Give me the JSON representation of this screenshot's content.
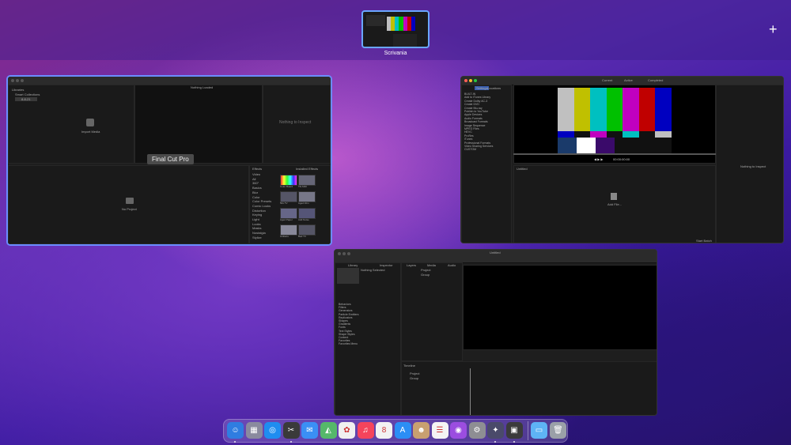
{
  "mission_control": {
    "desktop_label": "Scrivania",
    "add_space": "+"
  },
  "window_fcp": {
    "tooltip": "Final Cut Pro",
    "library": "Libraries",
    "events": [
      "Smart Collections",
      "8-8-21"
    ],
    "import_label": "Import Media",
    "viewer_title": "Nothing Loaded",
    "inspector_empty": "Nothing to Inspect",
    "timeline_empty": "No Project",
    "effects_title": "Effects",
    "effects_tab": "Installed Effects",
    "effects_categories": [
      "Video",
      "All",
      "360°",
      "Basics",
      "Blur",
      "Color",
      "Color Presets",
      "Comic Looks",
      "Distortion",
      "Keying",
      "Light",
      "Looks",
      "Masks",
      "Nostalgia",
      "Stylize"
    ],
    "effect_thumbs": [
      "Color Board",
      "Tilt-Shift",
      "50s TV",
      "Aged Film",
      "Aged Paper",
      "Add Noise",
      "Artifacts",
      "Bad TV"
    ]
  },
  "window_compressor": {
    "tabs": [
      "Current",
      "Active",
      "Completed"
    ],
    "sidebar_tabs": [
      "Settings",
      "Locations"
    ],
    "settings_list": [
      "BUILT-IN",
      "Add to iTunes Library",
      "Create Dolby AC-3",
      "Create DVD",
      "Create Blu-ray",
      "Publish to YouTube",
      "Apple Devices",
      "Audio Formats",
      "Broadcast Formats",
      "Image Sequence",
      "MPEG Files",
      "HEVC",
      "ProRes",
      "iTunes",
      "Professional Formats",
      "Video Sharing Services",
      "CUSTOM"
    ],
    "timecode": "00:00:00:00",
    "batch_label": "Untitled",
    "add_label": "Add File...",
    "inspector_empty": "Nothing to Inspect",
    "start_batch": "Start Batch"
  },
  "window_motion": {
    "title": "Untitled",
    "panels": [
      "Library",
      "Inspector",
      "Layers",
      "Media",
      "Audio"
    ],
    "project_name": "Nothing Selected",
    "library_list": [
      "Behaviors",
      "Filters",
      "Generators",
      "Particle Emitters",
      "Replicators",
      "Shapes",
      "Gradients",
      "Fonts",
      "Text Styles",
      "Shape Styles",
      "Content",
      "Favorites",
      "Favorites Menu"
    ],
    "layer_project": "Project",
    "layer_group": "Group",
    "timeline_label": "Timeline"
  },
  "colors": {
    "bars": [
      "#c0c0c0",
      "#c0c000",
      "#00c0c0",
      "#00c000",
      "#c000c0",
      "#c00000",
      "#0000c0"
    ],
    "accent": "#6b8cff"
  },
  "dock": {
    "apps": [
      {
        "name": "finder-icon",
        "glyph": "☺",
        "color": "#2f7de1",
        "running": true
      },
      {
        "name": "launchpad-icon",
        "glyph": "▦",
        "color": "#8a8a9e",
        "running": false
      },
      {
        "name": "safari-icon",
        "glyph": "◎",
        "color": "#1f8df0",
        "running": false
      },
      {
        "name": "final-cut-pro-icon",
        "glyph": "✂",
        "color": "#3a3a3a",
        "running": true
      },
      {
        "name": "mail-icon",
        "glyph": "✉",
        "color": "#3a8ff5",
        "running": false
      },
      {
        "name": "maps-icon",
        "glyph": "◭",
        "color": "#55b86a",
        "running": false
      },
      {
        "name": "photos-icon",
        "glyph": "✿",
        "color": "#f0f0f0",
        "running": false
      },
      {
        "name": "music-icon",
        "glyph": "♫",
        "color": "#f5445c",
        "running": false
      },
      {
        "name": "calendar-icon",
        "glyph": "8",
        "color": "#f2f2f2",
        "running": false
      },
      {
        "name": "app-store-icon",
        "glyph": "A",
        "color": "#2b8ef5",
        "running": false
      },
      {
        "name": "contacts-icon",
        "glyph": "☻",
        "color": "#c8a070",
        "running": false
      },
      {
        "name": "reminders-icon",
        "glyph": "☰",
        "color": "#f4f4f4",
        "running": false
      },
      {
        "name": "podcasts-icon",
        "glyph": "◉",
        "color": "#9b4de0",
        "running": false
      },
      {
        "name": "system-preferences-icon",
        "glyph": "⚙",
        "color": "#8e8e93",
        "running": false
      },
      {
        "name": "motion-icon",
        "glyph": "✦",
        "color": "#4a4a6a",
        "running": true
      },
      {
        "name": "compressor-icon",
        "glyph": "▣",
        "color": "#3b3b3b",
        "running": true
      }
    ],
    "others": [
      {
        "name": "downloads-folder-icon",
        "glyph": "▭",
        "color": "#5eb3f5"
      },
      {
        "name": "trash-icon",
        "glyph": "🗑",
        "color": "#9aa0a8"
      }
    ]
  }
}
